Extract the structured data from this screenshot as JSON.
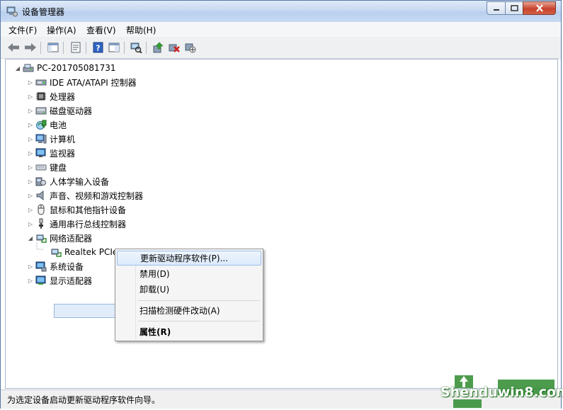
{
  "window": {
    "title": "设备管理器"
  },
  "menu": [
    "文件(F)",
    "操作(A)",
    "查看(V)",
    "帮助(H)"
  ],
  "tree": {
    "root": "PC-201705081731",
    "items": [
      {
        "label": "IDE ATA/ATAPI 控制器",
        "icon": "ide-controller-icon"
      },
      {
        "label": "处理器",
        "icon": "processor-icon"
      },
      {
        "label": "磁盘驱动器",
        "icon": "disk-drive-icon"
      },
      {
        "label": "电池",
        "icon": "battery-icon"
      },
      {
        "label": "计算机",
        "icon": "computer-icon"
      },
      {
        "label": "监视器",
        "icon": "monitor-icon"
      },
      {
        "label": "键盘",
        "icon": "keyboard-icon"
      },
      {
        "label": "人体学输入设备",
        "icon": "hid-icon"
      },
      {
        "label": "声音、视频和游戏控制器",
        "icon": "sound-icon"
      },
      {
        "label": "鼠标和其他指针设备",
        "icon": "mouse-icon"
      },
      {
        "label": "通用串行总线控制器",
        "icon": "usb-icon"
      },
      {
        "label": "网络适配器",
        "icon": "network-adapter-icon"
      },
      {
        "label": "系统设备",
        "icon": "system-device-icon"
      },
      {
        "label": "显示适配器",
        "icon": "display-adapter-icon"
      }
    ],
    "child_selected": "Realtek PCIe"
  },
  "context_menu": {
    "update": "更新驱动程序软件(P)...",
    "disable": "禁用(D)",
    "uninstall": "卸载(U)",
    "scan": "扫描检测硬件改动(A)",
    "properties": "属性(R)"
  },
  "status": "为选定设备启动更新驱动程序软件向导。",
  "watermark": "Shenduwin8.com"
}
